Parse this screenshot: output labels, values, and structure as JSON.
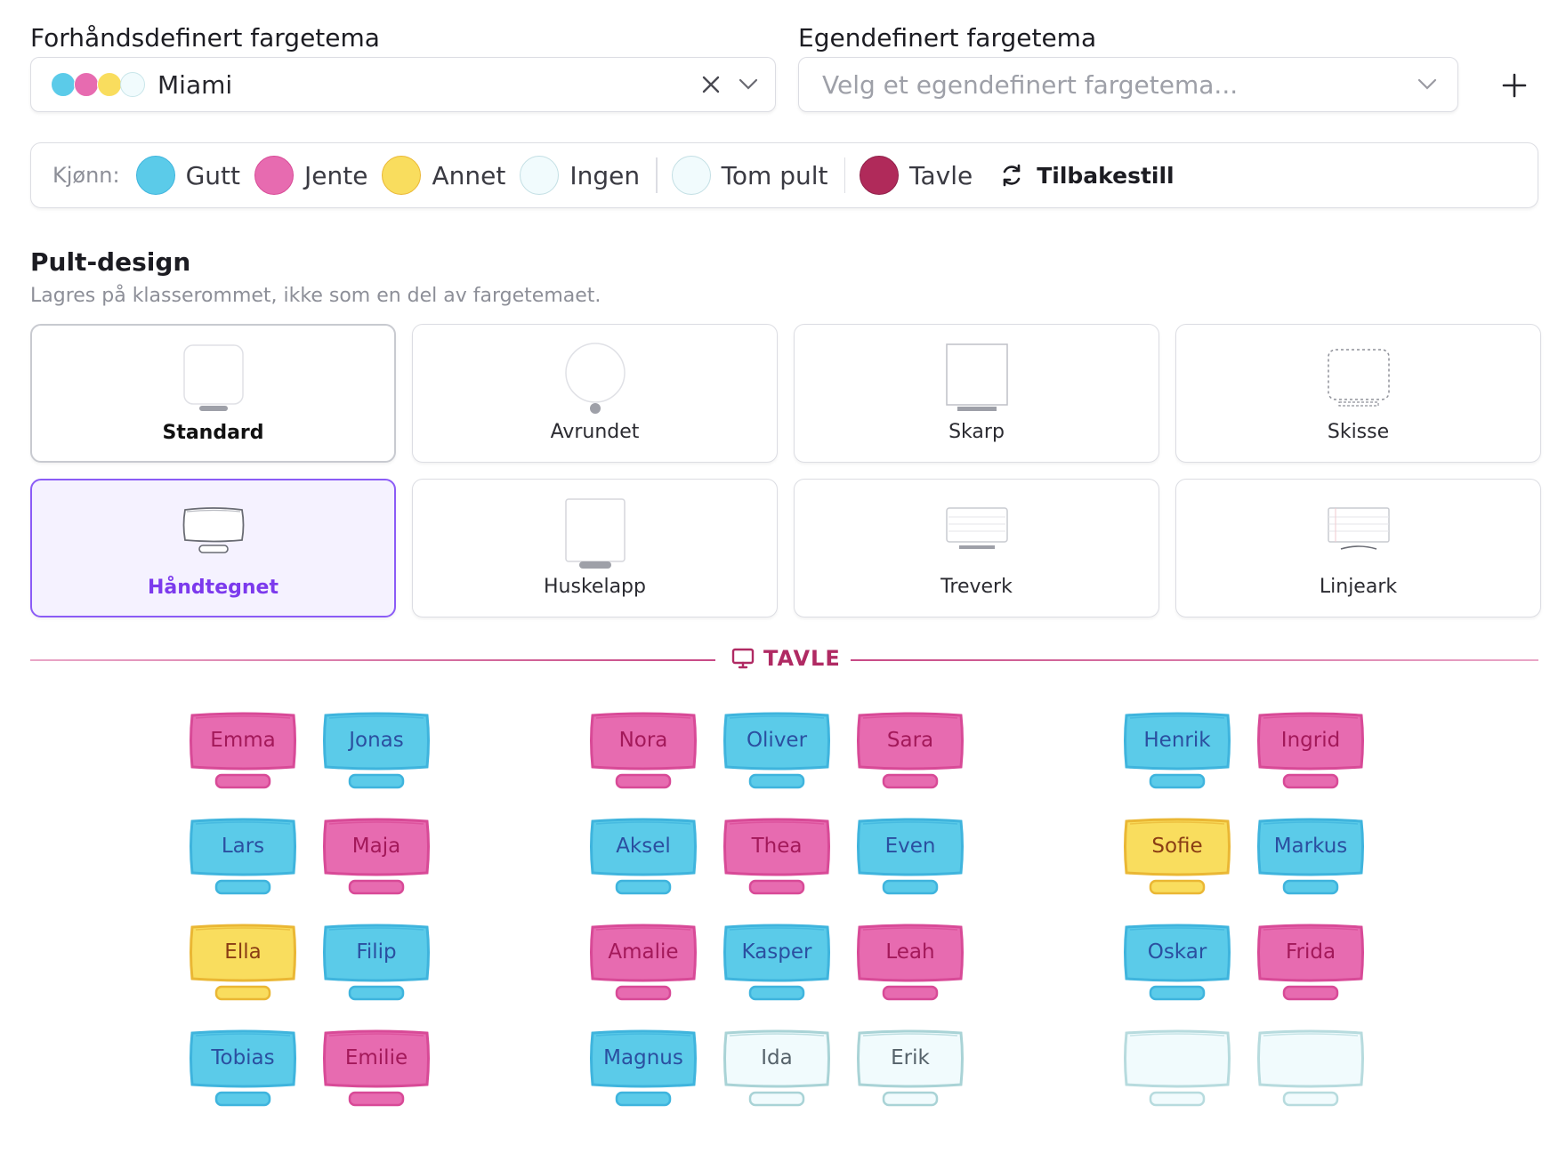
{
  "theme": {
    "preset_label": "Forhåndsdefinert fargetema",
    "preset_value": "Miami",
    "preset_dots": [
      "#5bcbe9",
      "#e76bb0",
      "#f9dd5e",
      "#f1fbfd"
    ],
    "custom_label": "Egendefinert fargetema",
    "custom_placeholder": "Velg et egendefinert fargetema..."
  },
  "legend": {
    "label": "Kjønn:",
    "items": [
      {
        "text": "Gutt",
        "color": "#5bcbe9"
      },
      {
        "text": "Jente",
        "color": "#e76bb0"
      },
      {
        "text": "Annet",
        "color": "#f9dd5e"
      },
      {
        "text": "Ingen",
        "color": "#f1fbfd"
      },
      {
        "text": "Tom pult",
        "color": "#f1fbfd"
      },
      {
        "text": "Tavle",
        "color": "#b02a5a"
      }
    ],
    "reset_label": "Tilbakestill"
  },
  "design": {
    "title": "Pult-design",
    "subtitle": "Lagres på klasserommet, ikke som en del av fargetemaet.",
    "options": [
      {
        "label": "Standard",
        "icon": "standard-desk-icon"
      },
      {
        "label": "Avrundet",
        "icon": "rounded-desk-icon"
      },
      {
        "label": "Skarp",
        "icon": "sharp-desk-icon"
      },
      {
        "label": "Skisse",
        "icon": "sketch-desk-icon"
      },
      {
        "label": "Håndtegnet",
        "icon": "handdrawn-desk-icon"
      },
      {
        "label": "Huskelapp",
        "icon": "sticky-note-desk-icon"
      },
      {
        "label": "Treverk",
        "icon": "wood-desk-icon"
      },
      {
        "label": "Linjeark",
        "icon": "lined-sheet-desk-icon"
      }
    ],
    "selected": "Håndtegnet"
  },
  "board_label": "TAVLE",
  "colors": {
    "gutt": {
      "fill": "#5bcbe9",
      "stroke": "#3fb4dd",
      "text": "#2b4fa0"
    },
    "jente": {
      "fill": "#e76bb0",
      "stroke": "#d84a97",
      "text": "#a3195a"
    },
    "annet": {
      "fill": "#f9dd5e",
      "stroke": "#eab734",
      "text": "#8a3d14"
    },
    "ingen": {
      "fill": "#f1fbfd",
      "stroke": "#a9d3d6",
      "text": "#55626a"
    },
    "tom": {
      "fill": "#f1fbfd",
      "stroke": "#b7dbde",
      "text": "#55626a"
    }
  },
  "desks": [
    {
      "name": "Emma",
      "g": "jente"
    },
    {
      "name": "Jonas",
      "g": "gutt"
    },
    {
      "name": "Nora",
      "g": "jente"
    },
    {
      "name": "Oliver",
      "g": "gutt"
    },
    {
      "name": "Sara",
      "g": "jente"
    },
    {
      "name": "Henrik",
      "g": "gutt"
    },
    {
      "name": "Ingrid",
      "g": "jente"
    },
    {
      "name": "Lars",
      "g": "gutt"
    },
    {
      "name": "Maja",
      "g": "jente"
    },
    {
      "name": "Aksel",
      "g": "gutt"
    },
    {
      "name": "Thea",
      "g": "jente"
    },
    {
      "name": "Even",
      "g": "gutt"
    },
    {
      "name": "Sofie",
      "g": "annet"
    },
    {
      "name": "Markus",
      "g": "gutt"
    },
    {
      "name": "Ella",
      "g": "annet"
    },
    {
      "name": "Filip",
      "g": "gutt"
    },
    {
      "name": "Amalie",
      "g": "jente"
    },
    {
      "name": "Kasper",
      "g": "gutt"
    },
    {
      "name": "Leah",
      "g": "jente"
    },
    {
      "name": "Oskar",
      "g": "gutt"
    },
    {
      "name": "Frida",
      "g": "jente"
    },
    {
      "name": "Tobias",
      "g": "gutt"
    },
    {
      "name": "Emilie",
      "g": "jente"
    },
    {
      "name": "Magnus",
      "g": "gutt"
    },
    {
      "name": "Ida",
      "g": "ingen"
    },
    {
      "name": "Erik",
      "g": "ingen"
    },
    {
      "name": "",
      "g": "tom"
    },
    {
      "name": "",
      "g": "tom"
    }
  ]
}
